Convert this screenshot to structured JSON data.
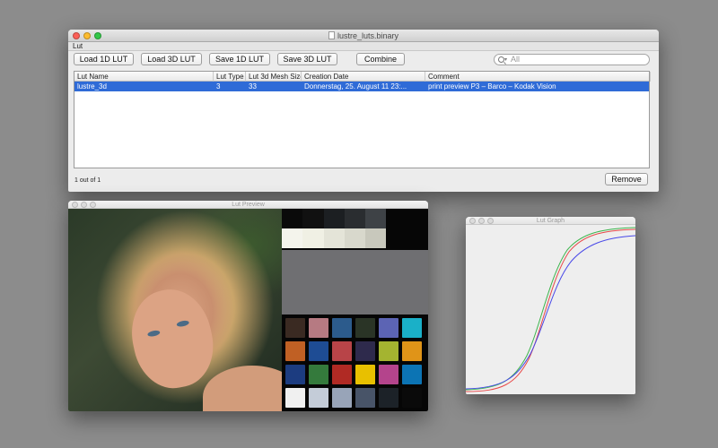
{
  "main_window": {
    "title": "lustre_luts.binary",
    "menu": [
      "Lut"
    ],
    "buttons": {
      "load_1d": "Load 1D LUT",
      "load_3d": "Load 3D LUT",
      "save_1d": "Save 1D LUT",
      "save_3d": "Save 3D LUT",
      "combine": "Combine",
      "remove": "Remove"
    },
    "search": {
      "placeholder": "All"
    },
    "table": {
      "columns": [
        "Lut Name",
        "Lut Type",
        "Lut 3d Mesh Size",
        "Creation Date",
        "Comment"
      ],
      "rows": [
        {
          "name": "lustre_3d",
          "type": "3",
          "mesh": "33",
          "date": "Donnerstag, 25. August 11 23:...",
          "comment": "print preview P3 – Barco – Kodak Vision",
          "selected": true
        }
      ]
    },
    "status": "1 out of 1"
  },
  "preview_window": {
    "title": "Lut Preview",
    "chart_colors": {
      "top_row": [
        "#0a0a0a",
        "#111111",
        "#1c1f22",
        "#2a2d30",
        "#3e4246",
        "#060606",
        "#060606"
      ],
      "light_row": [
        "#f4f4ec",
        "#f0f0e4",
        "#e4e4d8",
        "#d8d8cc",
        "#c8c8bc",
        "#060606",
        "#060606"
      ],
      "patches": [
        [
          "#3a2a22",
          "#b67a82",
          "#2c5b8c",
          "#2a3426",
          "#5c64b4",
          "#1ab0c8"
        ],
        [
          "#c06024",
          "#1e4c94",
          "#b84448",
          "#2e2a4c",
          "#a4b430",
          "#e09418"
        ],
        [
          "#1c3c80",
          "#347a3c",
          "#b02a24",
          "#e8c000",
          "#b4448c",
          "#0c74b4"
        ],
        [
          "#f0f0f0",
          "#c4ccd8",
          "#98a4b8",
          "#485468",
          "#1c2228",
          "#0a0a0a"
        ]
      ]
    }
  },
  "graph_window": {
    "title": "Lut Graph",
    "curve_colors": [
      "#e84848",
      "#3cb44c",
      "#4848e8"
    ]
  }
}
